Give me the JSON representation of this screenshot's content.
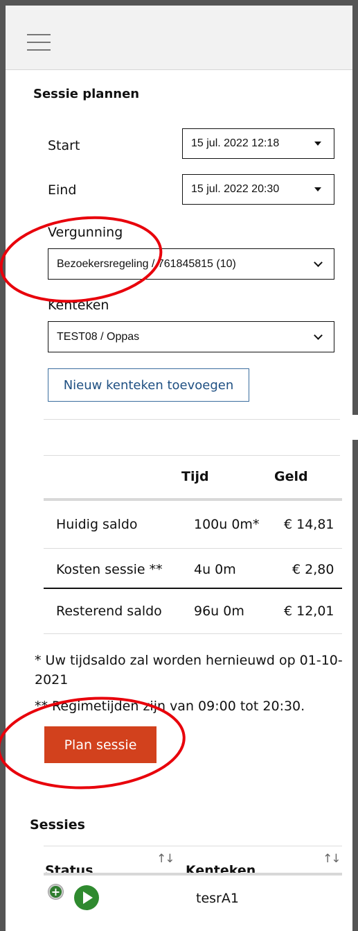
{
  "menu": {
    "icon": "hamburger-menu-icon"
  },
  "plan": {
    "title": "Sessie plannen",
    "start_label": "Start",
    "start_value": "15 jul. 2022 12:18",
    "end_label": "Eind",
    "end_value": "15 jul. 2022 20:30",
    "permit_label": "Vergunning",
    "permit_value": "Bezoekersregeling / 761845815 (10)",
    "plate_label": "Kenteken",
    "plate_value": "TEST08 / Oppas",
    "add_plate_button": "Nieuw kenteken toevoegen"
  },
  "balance": {
    "col_time": "Tijd",
    "col_money": "Geld",
    "rows": [
      {
        "label": "Huidig saldo",
        "time": "100u 0m*",
        "money": "€ 14,81"
      },
      {
        "label": "Kosten sessie **",
        "time": "4u 0m",
        "money": "€ 2,80"
      },
      {
        "label": "Resterend saldo",
        "time": "96u 0m",
        "money": "€ 12,01"
      }
    ],
    "note1": "* Uw tijdsaldo zal worden hernieuwd op 01-10-2021",
    "note2": "** Regimetijden zijn van 09:00 tot 20:30."
  },
  "plan_button": "Plan sessie",
  "sessions": {
    "title": "Sessies",
    "col_status": "Status",
    "col_plate": "Kenteken",
    "sort_glyph": "↑↓",
    "rows": [
      {
        "plate": "tesrA1"
      }
    ]
  },
  "colors": {
    "accent_button": "#d2411d",
    "link_blue": "#1e4f82",
    "annotation_red": "#e8000b",
    "status_green": "#2f8a2f"
  }
}
